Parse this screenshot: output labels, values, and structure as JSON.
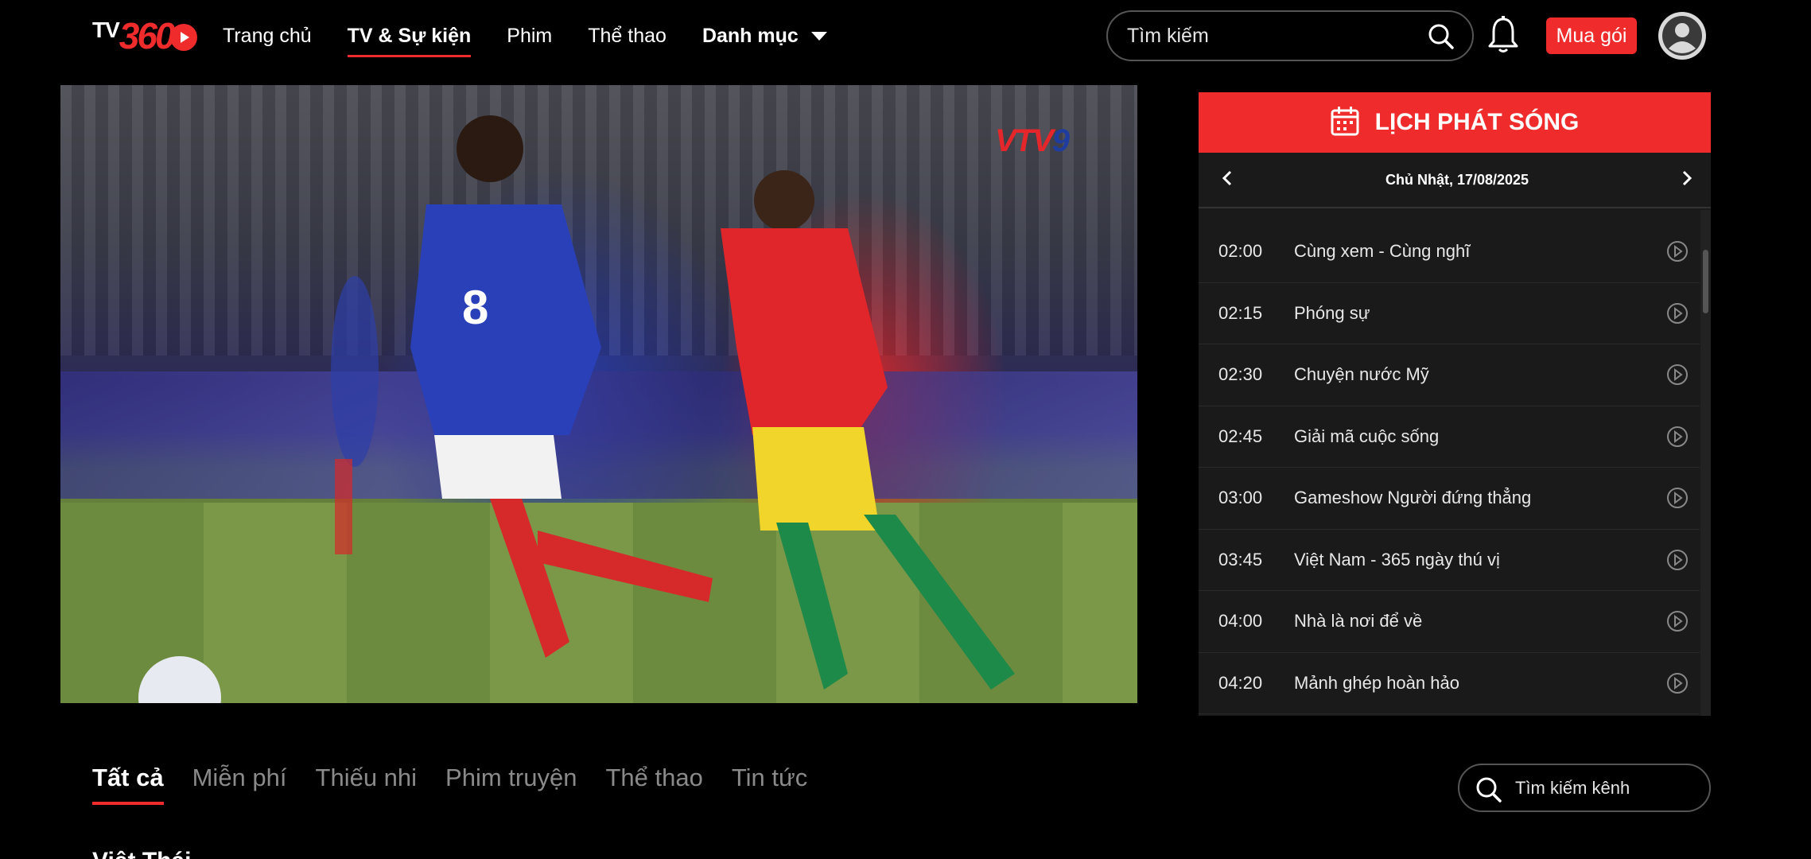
{
  "brand": {
    "tv": "TV",
    "num": "360"
  },
  "nav": {
    "items": [
      {
        "label": "Trang chủ"
      },
      {
        "label": "TV & Sự kiện"
      },
      {
        "label": "Phim"
      },
      {
        "label": "Thể thao"
      },
      {
        "label": "Danh mục"
      }
    ]
  },
  "search": {
    "placeholder": "Tìm kiếm"
  },
  "buy_label": "Mua gói",
  "player": {
    "channel_logo_red": "VTV",
    "channel_logo_blue": "9"
  },
  "schedule": {
    "title": "LỊCH PHÁT SÓNG",
    "date": "Chủ Nhật, 17/08/2025",
    "items": [
      {
        "time": "02:00",
        "name": "Cùng xem - Cùng nghĩ"
      },
      {
        "time": "02:15",
        "name": "Phóng sự"
      },
      {
        "time": "02:30",
        "name": "Chuyện nước Mỹ"
      },
      {
        "time": "02:45",
        "name": "Giải mã cuộc sống"
      },
      {
        "time": "03:00",
        "name": "Gameshow Người đứng thẳng"
      },
      {
        "time": "03:45",
        "name": "Việt Nam - 365 ngày thú vị"
      },
      {
        "time": "04:00",
        "name": "Nhà là nơi để về"
      },
      {
        "time": "04:20",
        "name": "Mảnh ghép hoàn hảo"
      }
    ]
  },
  "categories": [
    {
      "label": "Tất cả"
    },
    {
      "label": "Miễn phí"
    },
    {
      "label": "Thiếu nhi"
    },
    {
      "label": "Phim truyện"
    },
    {
      "label": "Thể thao"
    },
    {
      "label": "Tin tức"
    }
  ],
  "channel_search": {
    "placeholder": "Tìm kiếm kênh"
  },
  "section_title": "Việt Thái",
  "colors": {
    "accent": "#ef2b2b",
    "background": "#000000",
    "panel": "#1a1a1a"
  }
}
